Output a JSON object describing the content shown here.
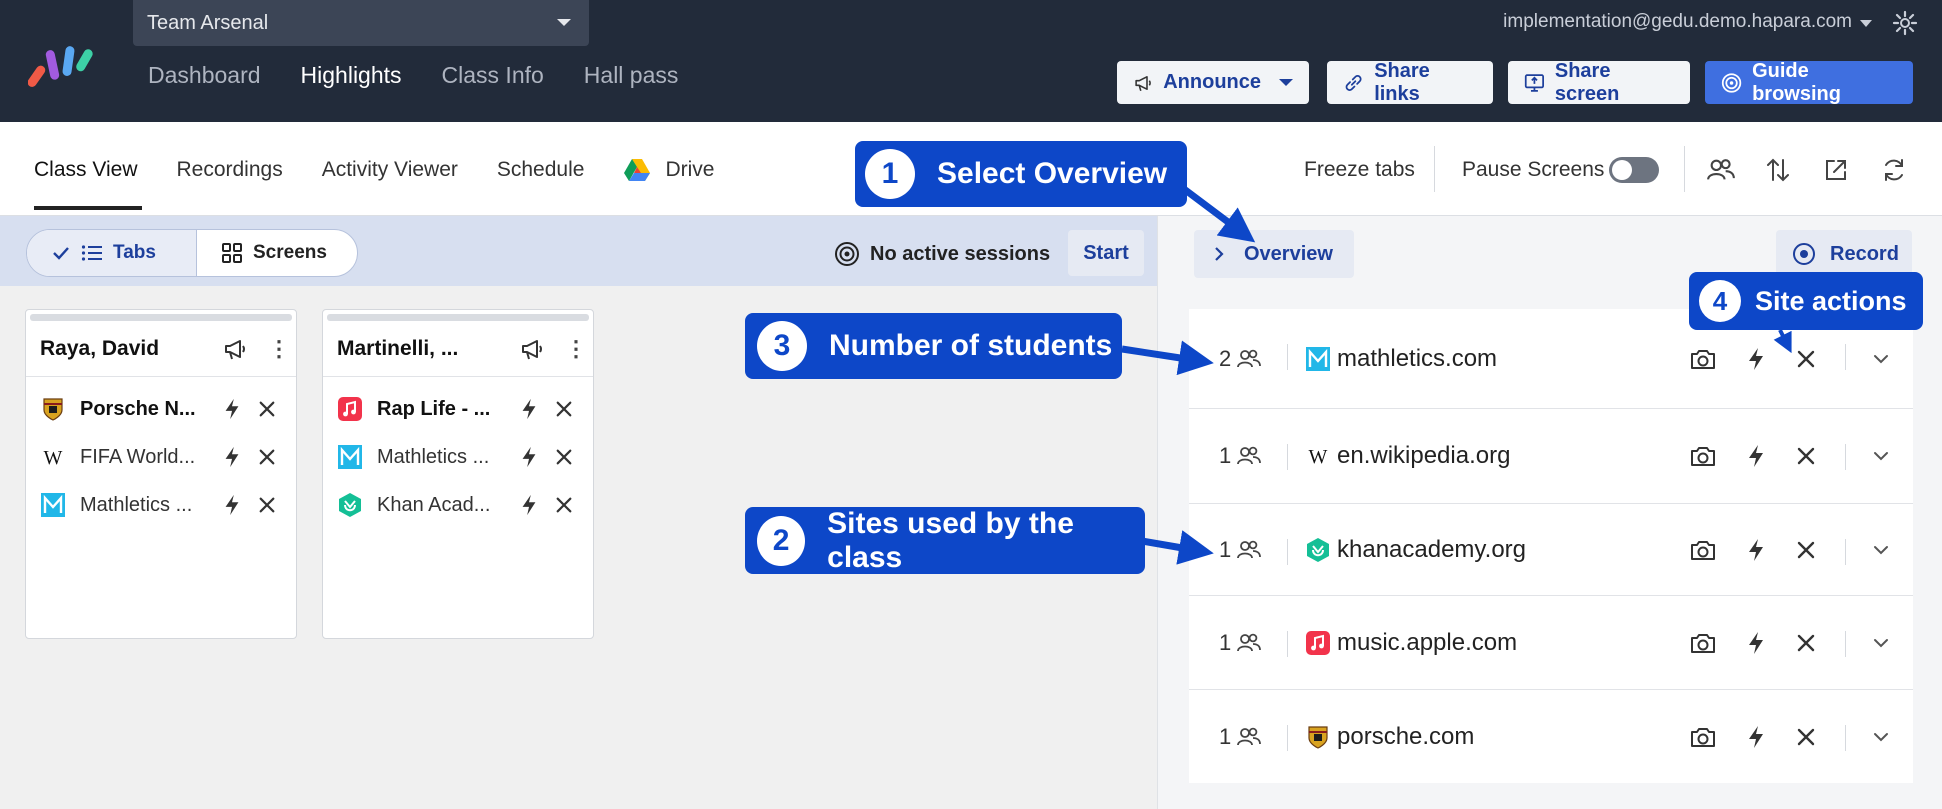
{
  "header": {
    "class_name": "Team Arsenal",
    "nav": [
      "Dashboard",
      "Highlights",
      "Class Info",
      "Hall pass"
    ],
    "active_nav": "Highlights",
    "user_email": "implementation@gedu.demo.hapara.com",
    "buttons": {
      "announce": "Announce",
      "share_links": "Share links",
      "share_screen": "Share screen",
      "guide_browsing": "Guide browsing"
    }
  },
  "subnav": {
    "tabs": [
      "Class View",
      "Recordings",
      "Activity Viewer",
      "Schedule",
      "Drive"
    ],
    "active_tab": "Class View",
    "freeze_tabs": "Freeze tabs",
    "pause_screens": "Pause Screens",
    "pause_screens_on": false
  },
  "view_toggle": {
    "tabs_label": "Tabs",
    "screens_label": "Screens",
    "selected": "Tabs"
  },
  "sessions": {
    "status": "No active sessions",
    "start_label": "Start"
  },
  "students": [
    {
      "name": "Raya, David",
      "tabs": [
        {
          "icon": "porsche-icon",
          "title": "Porsche N...",
          "bold": true
        },
        {
          "icon": "wikipedia-icon",
          "title": "FIFA World...",
          "bold": false
        },
        {
          "icon": "mathletics-icon",
          "title": "Mathletics ...",
          "bold": false
        }
      ]
    },
    {
      "name": "Martinelli, ...",
      "tabs": [
        {
          "icon": "apple-music-icon",
          "title": "Rap Life - ...",
          "bold": true
        },
        {
          "icon": "mathletics-icon",
          "title": "Mathletics ...",
          "bold": false
        },
        {
          "icon": "khan-academy-icon",
          "title": "Khan Acad...",
          "bold": false
        }
      ]
    }
  ],
  "overview": {
    "overview_label": "Overview",
    "record_label": "Record",
    "sites": [
      {
        "count": "2",
        "icon": "mathletics-icon",
        "domain": "mathletics.com"
      },
      {
        "count": "1",
        "icon": "wikipedia-icon",
        "domain": "en.wikipedia.org"
      },
      {
        "count": "1",
        "icon": "khan-academy-icon",
        "domain": "khanacademy.org"
      },
      {
        "count": "1",
        "icon": "apple-music-icon",
        "domain": "music.apple.com"
      },
      {
        "count": "1",
        "icon": "porsche-icon",
        "domain": "porsche.com"
      }
    ]
  },
  "callouts": [
    {
      "number": "1",
      "text": "Select Overview"
    },
    {
      "number": "2",
      "text": "Sites used by the class"
    },
    {
      "number": "3",
      "text": "Number of students"
    },
    {
      "number": "4",
      "text": "Site actions"
    }
  ],
  "colors": {
    "topbar": "#222b3a",
    "accent": "#1d3f9c",
    "primary_button": "#3f6fe0",
    "callout": "#0d47c8"
  }
}
